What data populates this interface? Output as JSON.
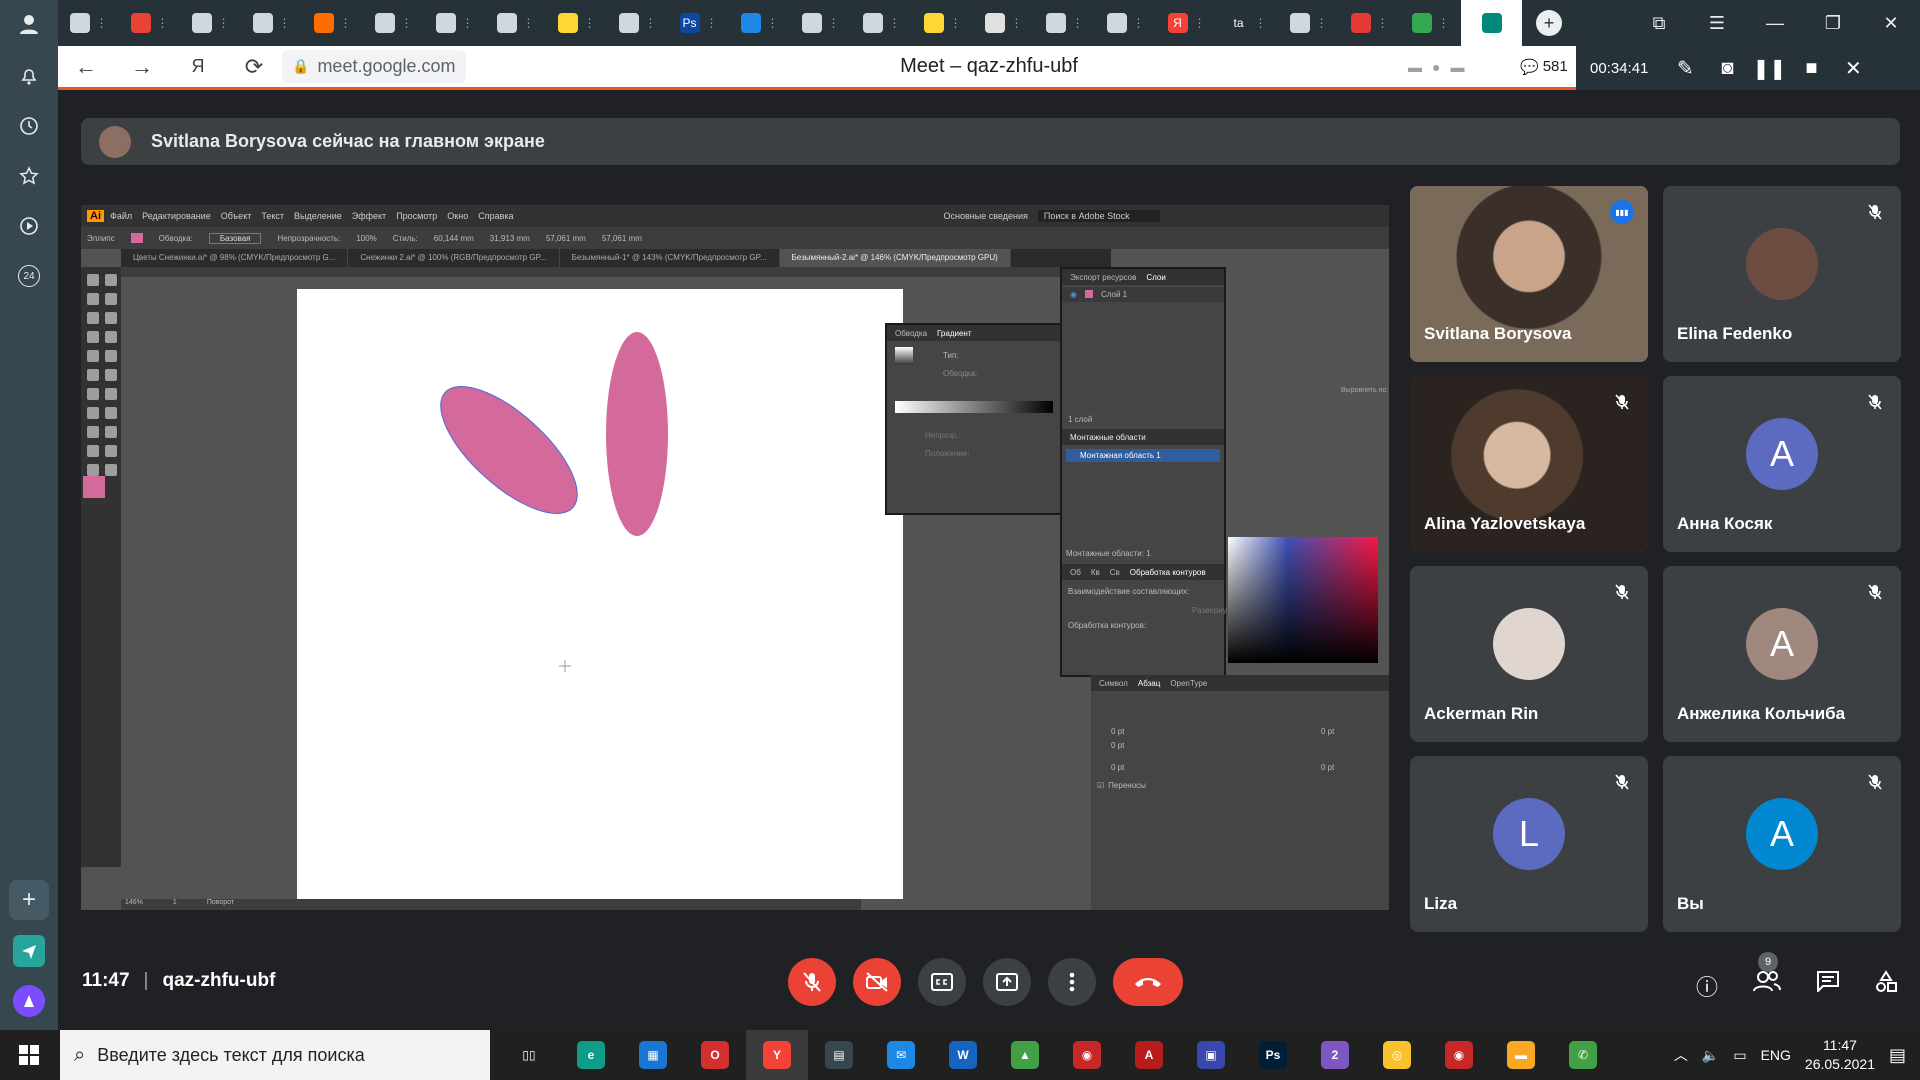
{
  "left_sidebar": {
    "items": [
      {
        "icon": "user-icon"
      },
      {
        "icon": "bell-icon"
      },
      {
        "icon": "history-icon"
      },
      {
        "icon": "star-icon"
      },
      {
        "icon": "play-icon"
      },
      {
        "icon": "news-24-icon",
        "label": "24"
      }
    ],
    "bottom": [
      {
        "icon": "add-icon",
        "glyph": "+"
      },
      {
        "icon": "send-app-icon"
      },
      {
        "icon": "alice-icon"
      }
    ]
  },
  "tabs": {
    "items": [
      {
        "icon": "doc-icon",
        "color": "#cfd8dc"
      },
      {
        "icon": "gmail-icon",
        "color": "#ea4335"
      },
      {
        "icon": "doc-icon",
        "color": "#cfd8dc"
      },
      {
        "icon": "doc-icon",
        "color": "#cfd8dc"
      },
      {
        "icon": "mail-icon",
        "color": "#ff6d00"
      },
      {
        "icon": "doc-icon",
        "color": "#cfd8dc"
      },
      {
        "icon": "doc-icon",
        "color": "#cfd8dc"
      },
      {
        "icon": "doc-icon",
        "color": "#cfd8dc"
      },
      {
        "icon": "smiley-icon",
        "color": "#fdd835"
      },
      {
        "icon": "doc-icon",
        "color": "#cfd8dc"
      },
      {
        "icon": "photoshop-icon",
        "color": "#0d47a1",
        "text": "Ps"
      },
      {
        "icon": "pen-icon",
        "color": "#1e88e5"
      },
      {
        "icon": "doc-icon",
        "color": "#cfd8dc"
      },
      {
        "icon": "doc-icon",
        "color": "#cfd8dc"
      },
      {
        "icon": "chat-icon",
        "color": "#fdd835"
      },
      {
        "icon": "swirl-icon",
        "color": "#e0e0e0"
      },
      {
        "icon": "doc-icon",
        "color": "#cfd8dc"
      },
      {
        "icon": "doc-icon",
        "color": "#cfd8dc"
      },
      {
        "icon": "yandex-icon",
        "color": "#f44336",
        "text": "Я"
      },
      {
        "icon": "ta-icon",
        "color": "#263238",
        "text": "ta"
      },
      {
        "icon": "doc-icon",
        "color": "#cfd8dc"
      },
      {
        "icon": "flag-icon",
        "color": "#e53935"
      },
      {
        "icon": "drive-icon",
        "color": "#34a853"
      }
    ],
    "active": {
      "icon": "meet-icon",
      "color": "#00897b"
    },
    "tab_separator": "⋮",
    "new_tab": "+",
    "window_controls": [
      "bookmarks",
      "menu",
      "minimize",
      "restore",
      "close"
    ]
  },
  "addressbar": {
    "url": "meet.google.com",
    "page_title": "Meet – qaz-zhfu-ubf",
    "chat_count": "581"
  },
  "recording_bar": {
    "time": "00:34:41"
  },
  "banner": {
    "text": "Svitlana Borysova сейчас на главном экране"
  },
  "illustrator": {
    "menu": [
      "Файл",
      "Редактирование",
      "Объект",
      "Текст",
      "Выделение",
      "Эффект",
      "Просмотр",
      "Окно",
      "Справка"
    ],
    "workspace": "Основные сведения",
    "stock_search": "Поиск в Adobe Stock",
    "control": {
      "tool": "Эллипс",
      "stroke": "Обводка:",
      "style": "Базовая",
      "opacity_label": "Непрозрачность:",
      "opacity": "100%",
      "style_label": "Стиль:",
      "w": "60,144 mm",
      "h": "31,913 mm",
      "w2": "57,061 mm",
      "h2": "57,061 mm"
    },
    "doc_tabs": [
      "Цветы Снежинки.ai* @ 98% (CMYK/Предпросмотр G...",
      "Снежинки 2.ai* @ 100% (RGB/Предпросмотр GP...",
      "Безымянный-1* @ 143% (CMYK/Предпросмотр GP...",
      "Безымянный-2.ai* @ 146% (CMYK/Предпросмотр GPU)"
    ],
    "active_doc_tab": 3,
    "petal_color": "#d4699b",
    "gradient_panel": {
      "tabs": [
        "Обводка",
        "Градиент"
      ],
      "type_label": "Тип:",
      "stroke_label": "Обводка:",
      "opacity_label": "Непрозр.:",
      "position_label": "Положение:"
    },
    "layers_panel": {
      "tabs": [
        "Экспорт ресурсов",
        "Слои"
      ],
      "layer": "Слой 1",
      "count": "1 слой"
    },
    "artboards_panel": {
      "title": "Монтажные области",
      "item": "Монтажная область 1",
      "footer": "Монтажные области: 1"
    },
    "pathfinder_panel": {
      "tabs": [
        "Об",
        "Кв",
        "Св",
        "Обработка контуров"
      ],
      "shape_modes": "Взаимодействие составляющих:",
      "pathfinders": "Обработка контуров:",
      "expand": "Развернуть"
    },
    "paragraph_panel": {
      "tabs": [
        "Символ",
        "Абзац",
        "OpenType"
      ],
      "values": [
        "0 pt",
        "0 pt",
        "0 pt",
        "0 pt",
        "0 pt"
      ],
      "hyphenate": "Переносы"
    },
    "align_hint": "Выровнять по:",
    "zoom": "146%",
    "page": "1",
    "status": "Поворот"
  },
  "participants": [
    {
      "name": "Svitlana Borysova",
      "type": "video",
      "muted": false,
      "speaking": true
    },
    {
      "name": "Elina Fedenko",
      "type": "photo",
      "muted": true,
      "avatar_color": "#6d4c41"
    },
    {
      "name": "Alina Yazlovetskaya",
      "type": "video",
      "muted": true
    },
    {
      "name": "Анна Косяк",
      "type": "letter",
      "letter": "A",
      "muted": true,
      "avatar_color": "#5c6bc0"
    },
    {
      "name": "Ackerman Rin",
      "type": "photo",
      "muted": true,
      "avatar_color": "#e0d6cf"
    },
    {
      "name": "Анжелика Кольчиба",
      "type": "letter",
      "letter": "A",
      "muted": true,
      "avatar_color": "#a1887f"
    },
    {
      "name": "Liza",
      "type": "letter",
      "letter": "L",
      "muted": true,
      "avatar_color": "#5c6bc0"
    },
    {
      "name": "Вы",
      "type": "letter",
      "letter": "A",
      "muted": true,
      "avatar_color": "#0288d1"
    }
  ],
  "meet_bar": {
    "time": "11:47",
    "separator": "|",
    "code": "qaz-zhfu-ubf",
    "buttons": [
      {
        "name": "mic-off-button",
        "icon": "mic-off-icon",
        "red": true
      },
      {
        "name": "camera-off-button",
        "icon": "camera-off-icon",
        "red": true
      },
      {
        "name": "captions-button",
        "icon": "captions-icon",
        "red": false
      },
      {
        "name": "present-button",
        "icon": "present-icon",
        "red": false
      },
      {
        "name": "more-options-button",
        "icon": "more-icon",
        "red": false
      }
    ],
    "end_call": {
      "icon": "hangup-icon"
    },
    "participant_count": "9"
  },
  "taskbar": {
    "search_placeholder": "Введите здесь текст для поиска",
    "apps": [
      {
        "name": "task-view",
        "color": "#202020",
        "text": "▯▯"
      },
      {
        "name": "edge",
        "color": "#0f9d8a",
        "text": "e"
      },
      {
        "name": "calculator",
        "color": "#1976d2",
        "text": "▦"
      },
      {
        "name": "opera",
        "color": "#d32f2f",
        "text": "O"
      },
      {
        "name": "yandex-browser",
        "color": "#f44336",
        "text": "Y"
      },
      {
        "name": "store",
        "color": "#37474f",
        "text": "▤"
      },
      {
        "name": "mail",
        "color": "#1e88e5",
        "text": "✉"
      },
      {
        "name": "word",
        "color": "#1565c0",
        "text": "W"
      },
      {
        "name": "maps-app",
        "color": "#43a047",
        "text": "▲"
      },
      {
        "name": "camera-app",
        "color": "#c62828",
        "text": "◉"
      },
      {
        "name": "acrobat",
        "color": "#b71c1c",
        "text": "A"
      },
      {
        "name": "save-app",
        "color": "#3949ab",
        "text": "▣"
      },
      {
        "name": "photoshop",
        "color": "#001e36",
        "text": "Ps"
      },
      {
        "name": "viber",
        "color": "#7e57c2",
        "text": "2"
      },
      {
        "name": "chrome",
        "color": "#fbc02d",
        "text": "◎"
      },
      {
        "name": "recorder",
        "color": "#c62828",
        "text": "◉"
      },
      {
        "name": "explorer",
        "color": "#f9a825",
        "text": "▬"
      },
      {
        "name": "whatsapp-like",
        "color": "#43a047",
        "text": "✆"
      }
    ],
    "active_app": 4,
    "lang": "ENG",
    "time": "11:47",
    "date": "26.05.2021"
  }
}
